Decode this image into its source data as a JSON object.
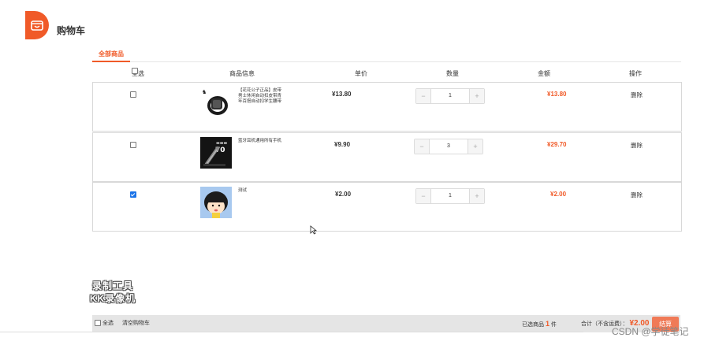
{
  "header": {
    "title": "购物车"
  },
  "tabs": [
    {
      "label": "全部商品",
      "active": true
    }
  ],
  "columns": {
    "select_all": "全选",
    "info": "商品信息",
    "price": "单价",
    "quantity": "数量",
    "amount": "金额",
    "actions": "操作"
  },
  "items": [
    {
      "name": "【花花公子正品】皮带男士休闲自动扣皮带青年百搭自动扣学生腰带",
      "price": "¥13.80",
      "qty": "1",
      "subtotal": "¥13.80",
      "checked": false,
      "delete_label": "删除"
    },
    {
      "name": "蓝牙耳机通用所有手机",
      "price": "¥9.90",
      "qty": "3",
      "subtotal": "¥29.70",
      "checked": false,
      "delete_label": "删除"
    },
    {
      "name": "测试",
      "price": "¥2.00",
      "qty": "1",
      "subtotal": "¥2.00",
      "checked": true,
      "delete_label": "删除"
    }
  ],
  "stepper": {
    "minus": "−",
    "plus": "+"
  },
  "footer": {
    "select_all": "全选",
    "clear_cart": "清空购物车",
    "selected_prefix": "已选商品",
    "selected_count": "1",
    "selected_suffix": "件",
    "total_label": "合计（不含运费）：",
    "total_value": "¥2.00",
    "settle_label": "结算"
  },
  "overlay": {
    "watermark_line1": "录制工具",
    "watermark_line2": "KK录像机",
    "csdn": "CSDN @学徒笔记"
  },
  "colors": {
    "accent": "#f05a28",
    "checkbox_checked": "#1a73e8"
  }
}
